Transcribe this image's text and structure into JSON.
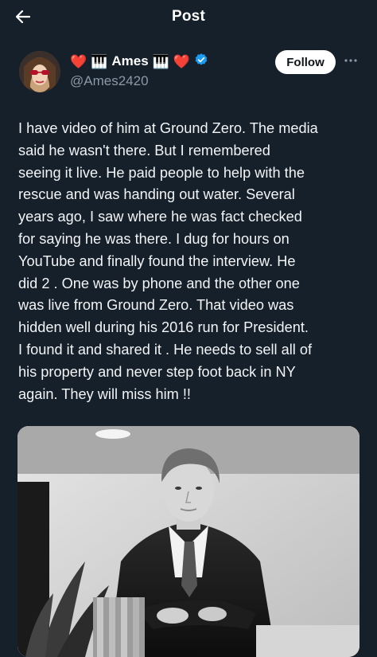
{
  "header": {
    "title": "Post",
    "back_icon": "arrow-left-icon"
  },
  "author": {
    "name": "Ames",
    "emoji_left": [
      "❤️",
      "🎹"
    ],
    "emoji_right": [
      "🎹",
      "❤️"
    ],
    "handle": "@Ames2420",
    "verified_icon": "verified-badge-icon",
    "verified_color": "#1d9bf0"
  },
  "actions": {
    "follow_label": "Follow",
    "more_icon": "more-dots-icon"
  },
  "post": {
    "lines": [
      "I have video of him at Ground Zero.  The media",
      "said he wasn't there.   But I remembered",
      "seeing it live.   He paid people to help with the",
      "rescue  and was handing out water.   Several",
      "years ago, I saw where he was fact checked",
      "for saying he was there.  I dug for hours on",
      "YouTube  and finally  found the interview.  He",
      "did 2 .  One was by phone and the other one",
      "was live from Ground  Zero. That video was",
      "hidden well during his 2016 run for President.",
      "I found it and shared it .  He needs to sell all of",
      "his property  and never step foot back in NY",
      "again.  They will miss him !!"
    ]
  },
  "media": {
    "kind": "black-and-white-portrait-photo"
  },
  "colors": {
    "background": "#15202b",
    "text": "#f2f4f5",
    "muted": "#8b98a5",
    "heart": "#e8313f"
  }
}
